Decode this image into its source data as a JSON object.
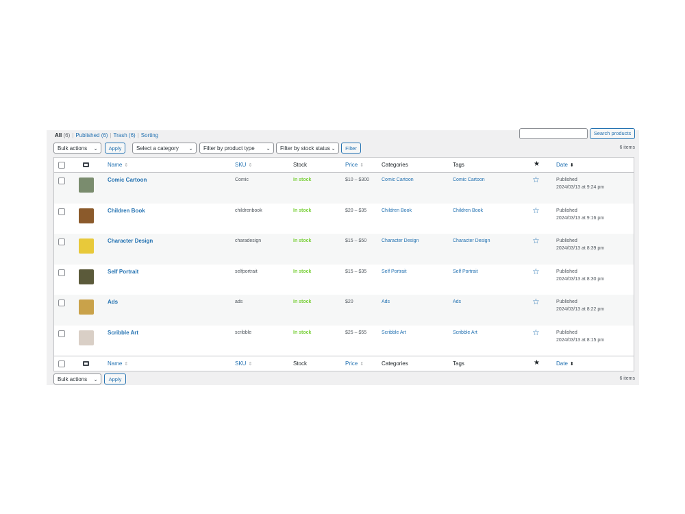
{
  "views": {
    "all": "All",
    "all_count": "(6)",
    "published": "Published (6)",
    "trash": "Trash (6)",
    "sorting": "Sorting"
  },
  "search": {
    "button": "Search products",
    "value": ""
  },
  "toolbar": {
    "bulk_actions": "Bulk actions",
    "apply": "Apply",
    "category": "Select a category",
    "product_type": "Filter by product type",
    "stock_status": "Filter by stock status",
    "filter": "Filter",
    "items_count": "6 items"
  },
  "columns": {
    "name": "Name",
    "sku": "SKU",
    "stock": "Stock",
    "price": "Price",
    "categories": "Categories",
    "tags": "Tags",
    "featured_icon": "star-filled-icon",
    "date": "Date"
  },
  "products": [
    {
      "name": "Comic Cartoon",
      "sku": "Comic",
      "stock": "In stock",
      "price": "$10 – $300",
      "category": "Comic Cartoon",
      "tag": "Comic Cartoon",
      "status": "Published",
      "date": "2024/03/13 at 9:24 pm",
      "thumb_color": "#7a8c6e"
    },
    {
      "name": "Children Book",
      "sku": "childrenbook",
      "stock": "In stock",
      "price": "$20 – $35",
      "category": "Children Book",
      "tag": "Children Book",
      "status": "Published",
      "date": "2024/03/13 at 9:16 pm",
      "thumb_color": "#8b5a2b"
    },
    {
      "name": "Character Design",
      "sku": "charadesign",
      "stock": "In stock",
      "price": "$15 – $50",
      "category": "Character Design",
      "tag": "Character Design",
      "status": "Published",
      "date": "2024/03/13 at 8:39 pm",
      "thumb_color": "#e8c93a"
    },
    {
      "name": "Self Portrait",
      "sku": "selfportrait",
      "stock": "In stock",
      "price": "$15 – $35",
      "category": "Self Portrait",
      "tag": "Self Portrait",
      "status": "Published",
      "date": "2024/03/13 at 8:30 pm",
      "thumb_color": "#5b5a3a"
    },
    {
      "name": "Ads",
      "sku": "ads",
      "stock": "In stock",
      "price": "$20",
      "category": "Ads",
      "tag": "Ads",
      "status": "Published",
      "date": "2024/03/13 at 8:22 pm",
      "thumb_color": "#c9a24a"
    },
    {
      "name": "Scribble Art",
      "sku": "scribble",
      "stock": "In stock",
      "price": "$25 – $55",
      "category": "Scribble Art",
      "tag": "Scribble Art",
      "status": "Published",
      "date": "2024/03/13 at 8:15 pm",
      "thumb_color": "#d9cfc6"
    }
  ],
  "colors": {
    "link": "#2271b1",
    "in_stock": "#7ad03a",
    "background": "#f0f0f1"
  }
}
